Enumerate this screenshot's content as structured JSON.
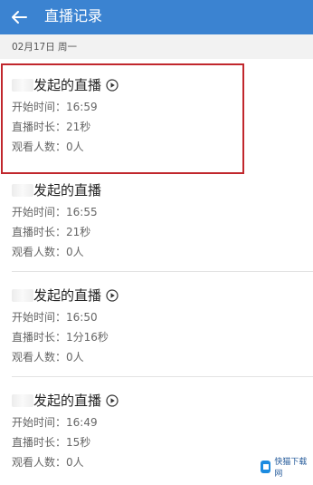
{
  "header": {
    "title": "直播记录",
    "bg_color": "#3b83d1"
  },
  "date_header": "02月17日 周一",
  "records": [
    {
      "title": "发起的直播",
      "start": "开始时间：16:59",
      "duration": "直播时长：21秒",
      "viewers": "观看人数：0人"
    },
    {
      "title": "发起的直播",
      "start": "开始时间：16:55",
      "duration": "直播时长：21秒",
      "viewers": "观看人数：0人"
    },
    {
      "title": "发起的直播",
      "start": "开始时间：16:50",
      "duration": "直播时长：1分16秒",
      "viewers": "观看人数：0人"
    },
    {
      "title": "发起的直播",
      "start": "开始时间：16:49",
      "duration": "直播时长：15秒",
      "viewers": "观看人数：0人"
    }
  ],
  "watermark": "快猫下载网",
  "colors": {
    "highlight": "#c1272d",
    "text_primary": "#222222",
    "text_secondary": "#666666"
  }
}
